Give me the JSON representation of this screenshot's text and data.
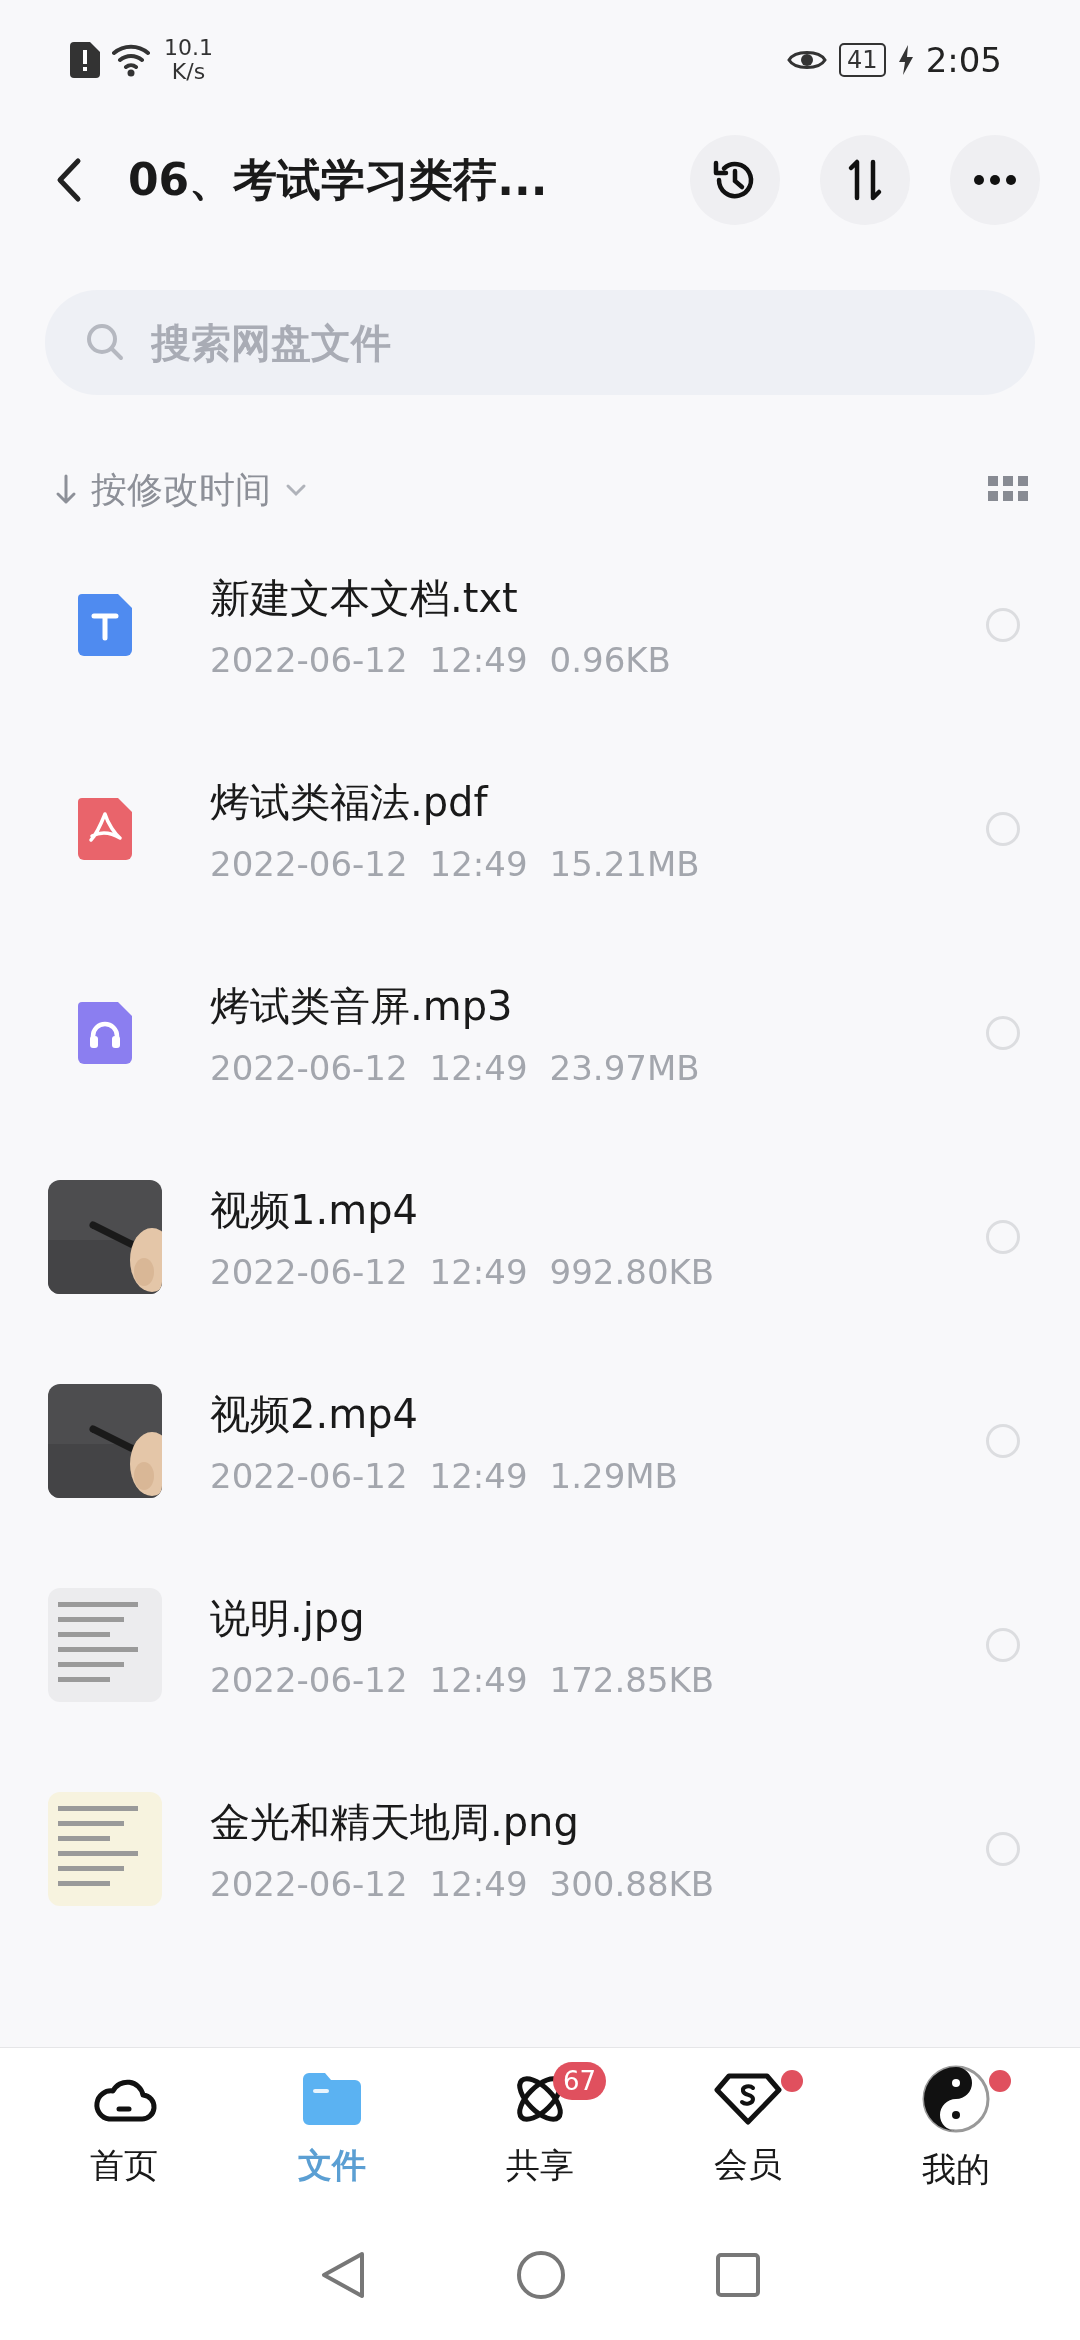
{
  "status_bar": {
    "network_speed": "10.1",
    "speed_unit": "K/s",
    "battery": "41",
    "time": "2:05"
  },
  "header": {
    "title": "06、考试学习类荇..."
  },
  "search": {
    "placeholder": "搜索网盘文件"
  },
  "sort": {
    "label": "按修改时间"
  },
  "files": [
    {
      "name": "新建文本文档.txt",
      "date": "2022-06-12",
      "time": "12:49",
      "size": "0.96KB",
      "kind": "txt",
      "selected": false
    },
    {
      "name": "烤试类福法.pdf",
      "date": "2022-06-12",
      "time": "12:49",
      "size": "15.21MB",
      "kind": "pdf",
      "selected": false
    },
    {
      "name": "烤试类音屏.mp3",
      "date": "2022-06-12",
      "time": "12:49",
      "size": "23.97MB",
      "kind": "audio",
      "selected": false
    },
    {
      "name": "视频1.mp4",
      "date": "2022-06-12",
      "time": "12:49",
      "size": "992.80KB",
      "kind": "video",
      "selected": false
    },
    {
      "name": "视频2.mp4",
      "date": "2022-06-12",
      "time": "12:49",
      "size": "1.29MB",
      "kind": "video",
      "selected": false
    },
    {
      "name": "说明.jpg",
      "date": "2022-06-12",
      "time": "12:49",
      "size": "172.85KB",
      "selected": false
    },
    {
      "name": "金光和精天地周.png",
      "date": "2022-06-12",
      "time": "12:49",
      "size": "300.88KB",
      "selected": false
    }
  ],
  "tabs": [
    {
      "label": "首页",
      "selected": false
    },
    {
      "label": "文件",
      "selected": true
    },
    {
      "label": "共享",
      "selected": false,
      "badge": "67"
    },
    {
      "label": "会员",
      "selected": false,
      "dot": true
    },
    {
      "label": "我的",
      "selected": false,
      "dot": true
    }
  ]
}
